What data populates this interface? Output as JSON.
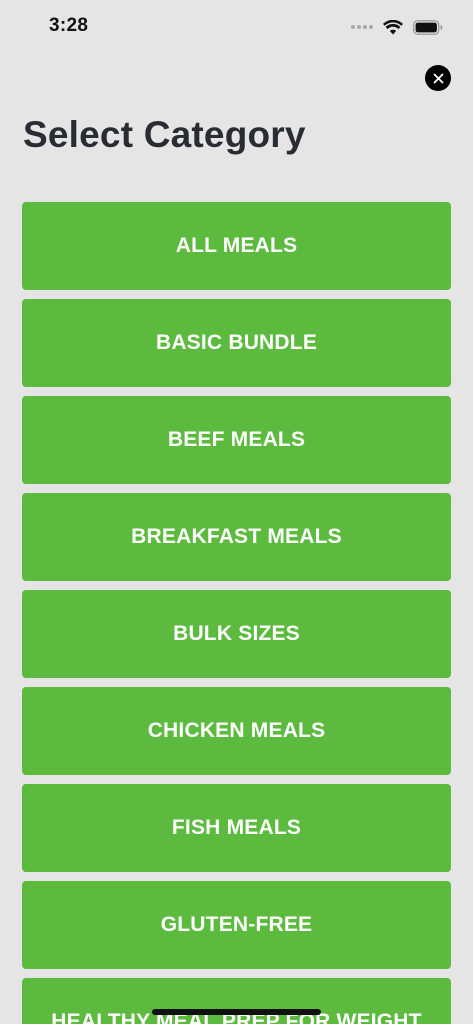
{
  "status_bar": {
    "time": "3:28"
  },
  "header": {
    "title": "Select Category",
    "close_icon": "close-icon"
  },
  "categories": [
    "ALL MEALS",
    "BASIC BUNDLE",
    "BEEF MEALS",
    "BREAKFAST MEALS",
    "BULK SIZES",
    "CHICKEN MEALS",
    "FISH MEALS",
    "GLUTEN-FREE",
    "HEALTHY MEAL PREP FOR WEIGHT"
  ],
  "colors": {
    "background": "#e5e5e5",
    "button": "#5cbb3f",
    "button_text": "#ffffff",
    "title": "#2a2c33"
  }
}
